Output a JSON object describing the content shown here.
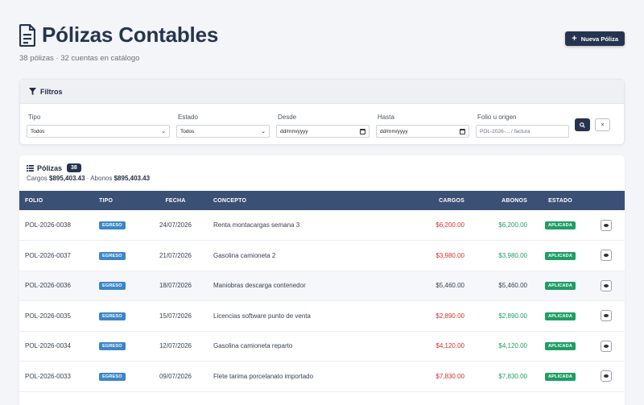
{
  "header": {
    "title": "Pólizas Contables",
    "subtitle": "38 pólizas · 32 cuentas en catálogo",
    "new_button": "Nueva Póliza"
  },
  "filters": {
    "title": "Filtros",
    "tipo": {
      "label": "Tipo",
      "value": "Todos"
    },
    "estado": {
      "label": "Estado",
      "value": "Todos"
    },
    "desde": {
      "label": "Desde",
      "value": "dd/mm/yyyy"
    },
    "hasta": {
      "label": "Hasta",
      "value": "dd/mm/yyyy"
    },
    "folio": {
      "label": "Folio u origen",
      "placeholder": "POL-2026-... / factura"
    },
    "clear_label": "×"
  },
  "table": {
    "title": "Pólizas",
    "count": "38",
    "totals_cargos_label": "Cargos",
    "totals_cargos": "$895,403.43",
    "totals_sep": "·",
    "totals_abonos_label": "Abonos",
    "totals_abonos": "$895,403.43",
    "columns": [
      "FOLIO",
      "TIPO",
      "FECHA",
      "CONCEPTO",
      "CARGOS",
      "ABONOS",
      "ESTADO",
      ""
    ],
    "rows": [
      {
        "folio": "POL-2026-0038",
        "tipo": "EGRESO",
        "fecha": "24/07/2026",
        "concepto": "Renta montacargas semana 3",
        "cargos": "$6,200.00",
        "abonos": "$6,200.00",
        "estado": "APLICADA",
        "colored": true
      },
      {
        "folio": "POL-2026-0037",
        "tipo": "EGRESO",
        "fecha": "21/07/2026",
        "concepto": "Gasolina camioneta 2",
        "cargos": "$3,980.00",
        "abonos": "$3,980.00",
        "estado": "APLICADA",
        "colored": true
      },
      {
        "folio": "POL-2026-0036",
        "tipo": "EGRESO",
        "fecha": "18/07/2026",
        "concepto": "Maniobras descarga contenedor",
        "cargos": "$5,460.00",
        "abonos": "$5,460.00",
        "estado": "APLICADA",
        "colored": false
      },
      {
        "folio": "POL-2026-0035",
        "tipo": "EGRESO",
        "fecha": "15/07/2026",
        "concepto": "Licencias software punto de venta",
        "cargos": "$2,890.00",
        "abonos": "$2,890.00",
        "estado": "APLICADA",
        "colored": true
      },
      {
        "folio": "POL-2026-0034",
        "tipo": "EGRESO",
        "fecha": "12/07/2026",
        "concepto": "Gasolina camioneta reparto",
        "cargos": "$4,120.00",
        "abonos": "$4,120.00",
        "estado": "APLICADA",
        "colored": true
      },
      {
        "folio": "POL-2026-0033",
        "tipo": "EGRESO",
        "fecha": "09/07/2026",
        "concepto": "Flete tarima porcelanato importado",
        "cargos": "$7,830.00",
        "abonos": "$7,830.00",
        "estado": "APLICADA",
        "colored": true
      }
    ]
  },
  "colors": {
    "primary": "#26344f",
    "table_header": "#3a5074",
    "egreso": "#3b86c9",
    "aplicada": "#1e9e64",
    "cargo": "#d92d2d",
    "abono": "#1e9e64"
  }
}
